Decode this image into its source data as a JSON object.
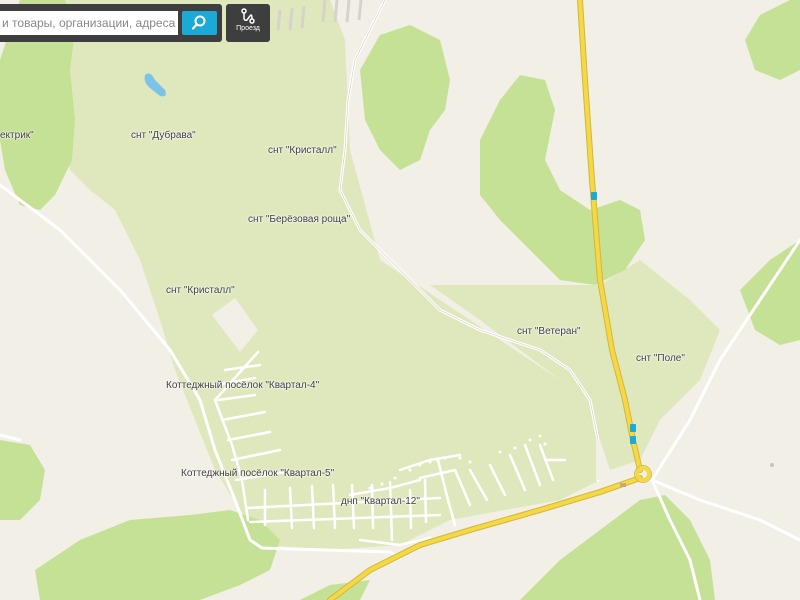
{
  "search": {
    "placeholder": "Поиск места, товары, организации, адреса",
    "visible_text": "и товары, организации, адреса"
  },
  "toolbar": {
    "route_label": "Проезд",
    "route_icon": "route-icon",
    "search_icon": "magnifier-icon"
  },
  "map": {
    "colors": {
      "background": "#f2efe6",
      "forest": "#c5e195",
      "light_green": "#dfe8bd",
      "road_major": "#f5d846",
      "road_major_outline": "#d3b73a",
      "road_minor": "#ffffff"
    },
    "labels": {
      "elektrik": "ектрик\"",
      "dubrava": "снт \"Дубрава\"",
      "kristall_1": "снт \"Кристалл\"",
      "berezovaya": "снт \"Берёзовая роща\"",
      "kristall_2": "снт \"Кристалл\"",
      "veteran": "снт \"Ветеран\"",
      "pole": "снт \"Поле\"",
      "kvartal4": "Коттеджный посёлок \"Квартал-4\"",
      "kvartal5": "Коттеджный посёлок \"Квартал-5\"",
      "kvartal12": "днп \"Квартал-12\""
    }
  }
}
